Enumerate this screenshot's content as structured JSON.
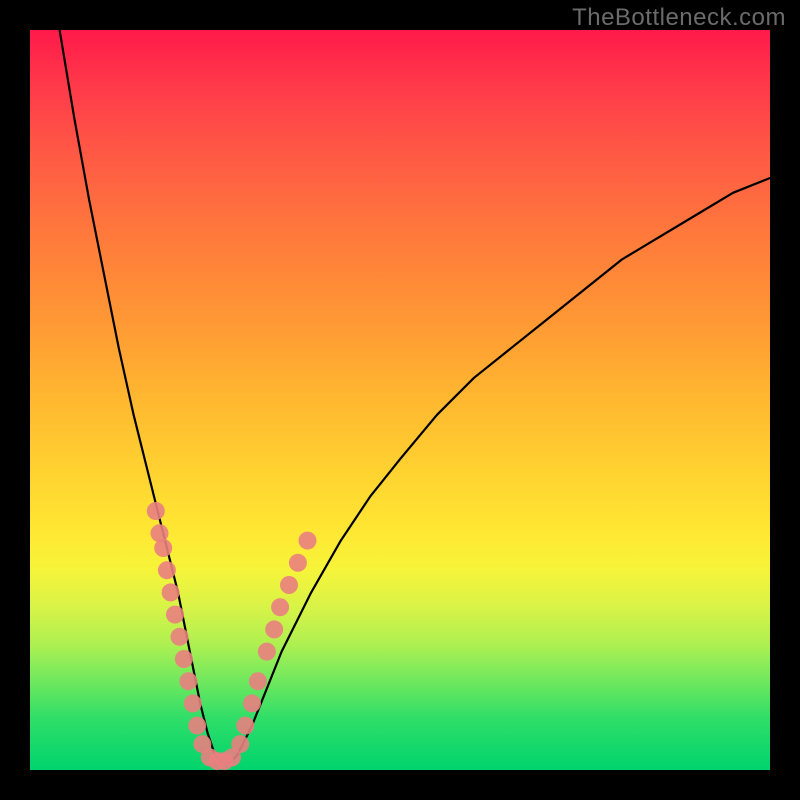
{
  "watermark": "TheBottleneck.com",
  "chart_data": {
    "type": "line",
    "title": "",
    "xlabel": "",
    "ylabel": "",
    "xlim": [
      0,
      100
    ],
    "ylim": [
      0,
      100
    ],
    "grid": false,
    "legend": false,
    "gradient_colors": [
      "#ff1a4a",
      "#ffe833",
      "#00d46d"
    ],
    "series": [
      {
        "name": "bottleneck-curve",
        "color": "#000000",
        "x": [
          4,
          6,
          8,
          10,
          12,
          14,
          16,
          18,
          20,
          22,
          23,
          24,
          25,
          26,
          27,
          28,
          30,
          32,
          34,
          38,
          42,
          46,
          50,
          55,
          60,
          65,
          70,
          75,
          80,
          85,
          90,
          95,
          100
        ],
        "y": [
          100,
          88,
          77,
          67,
          57,
          48,
          40,
          32,
          24,
          14,
          9,
          5,
          2,
          1,
          1,
          2,
          6,
          11,
          16,
          24,
          31,
          37,
          42,
          48,
          53,
          57,
          61,
          65,
          69,
          72,
          75,
          78,
          80
        ]
      }
    ],
    "marker_cluster": {
      "name": "data-points",
      "color": "#e98080",
      "radius_px": 9,
      "points": [
        {
          "x": 17.0,
          "y": 35
        },
        {
          "x": 17.5,
          "y": 32
        },
        {
          "x": 18.0,
          "y": 30
        },
        {
          "x": 18.5,
          "y": 27
        },
        {
          "x": 19.0,
          "y": 24
        },
        {
          "x": 19.6,
          "y": 21
        },
        {
          "x": 20.2,
          "y": 18
        },
        {
          "x": 20.8,
          "y": 15
        },
        {
          "x": 21.4,
          "y": 12
        },
        {
          "x": 22.0,
          "y": 9
        },
        {
          "x": 22.6,
          "y": 6
        },
        {
          "x": 23.3,
          "y": 3.5
        },
        {
          "x": 24.3,
          "y": 1.7
        },
        {
          "x": 25.3,
          "y": 1.2
        },
        {
          "x": 26.3,
          "y": 1.2
        },
        {
          "x": 27.3,
          "y": 1.7
        },
        {
          "x": 28.4,
          "y": 3.5
        },
        {
          "x": 29.1,
          "y": 6
        },
        {
          "x": 30.0,
          "y": 9
        },
        {
          "x": 30.8,
          "y": 12
        },
        {
          "x": 32.0,
          "y": 16
        },
        {
          "x": 33.0,
          "y": 19
        },
        {
          "x": 33.8,
          "y": 22
        },
        {
          "x": 35.0,
          "y": 25
        },
        {
          "x": 36.2,
          "y": 28
        },
        {
          "x": 37.5,
          "y": 31
        }
      ]
    }
  }
}
